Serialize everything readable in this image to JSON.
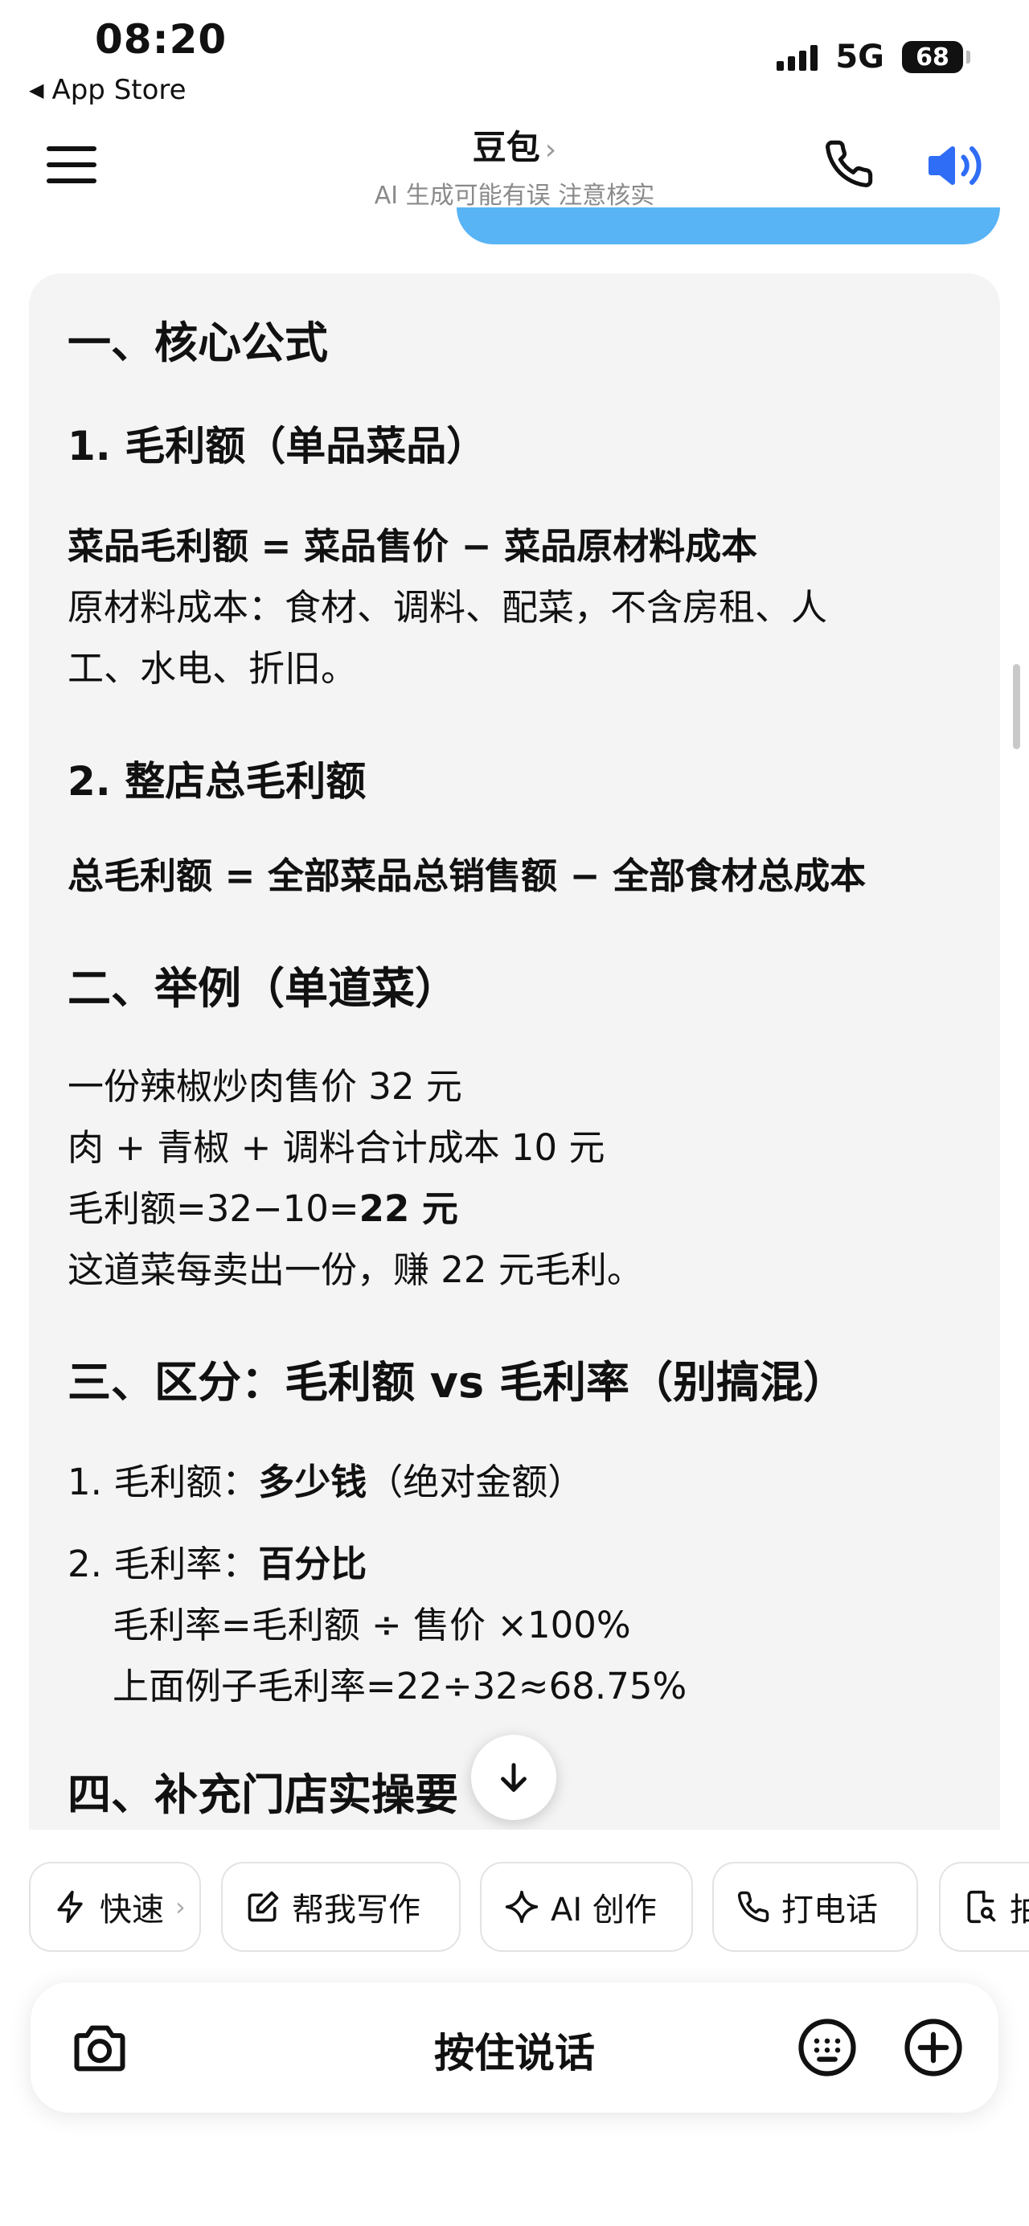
{
  "status_bar": {
    "time": "08:20",
    "back_app": "App Store",
    "network": "5G",
    "battery": "68"
  },
  "header": {
    "title": "豆包",
    "title_chevron": "›",
    "subtitle": "AI 生成可能有误 注意核实"
  },
  "message": {
    "s1_title": "一、核心公式",
    "s1_1_title": "1. 毛利额（单品菜品）",
    "s1_1_formula": "菜品毛利额 = 菜品售价 − 菜品原材料成本",
    "s1_1_note_line1": "原材料成本：食材、调料、配菜，不含房租、人",
    "s1_1_note_line2": "工、水电、折旧。",
    "s1_2_title": "2. 整店总毛利额",
    "s1_2_formula": "总毛利额 = 全部菜品总销售额 − 全部食材总成本",
    "s2_title": "二、举例（单道菜）",
    "s2_line1": "一份辣椒炒肉售价 32 元",
    "s2_line2": "肉 + 青椒 + 调料合计成本 10 元",
    "s2_line3_prefix": "毛利额=32−10=",
    "s2_line3_value": "22 元",
    "s2_line4": "这道菜每卖出一份，赚 22 元毛利。",
    "s3_title": "三、区分：毛利额 vs 毛利率（别搞混）",
    "s3_item1_label": "1. 毛利额：",
    "s3_item1_bold": "多少钱",
    "s3_item1_rest": "（绝对金额）",
    "s3_item2_label": "2. 毛利率：",
    "s3_item2_bold": "百分比",
    "s3_item2_formula": "毛利率=毛利额 ÷ 售价 ×100%",
    "s3_item2_example": "上面例子毛利率=22÷32≈68.75%",
    "s4_title_partial": "四、补充门店实操要"
  },
  "chips": [
    {
      "label": "快速",
      "icon": "lightning-icon",
      "chevron": "›"
    },
    {
      "label": "帮我写作",
      "icon": "edit-icon"
    },
    {
      "label": "AI 创作",
      "icon": "sparkle-icon"
    },
    {
      "label": "打电话",
      "icon": "phone-icon"
    },
    {
      "label": "拍",
      "icon": "document-search-icon"
    }
  ],
  "input_bar": {
    "hold_to_talk": "按住说话"
  },
  "colors": {
    "accent_blue": "#2f6df6",
    "bubble_blue": "#58b4f5",
    "card_bg": "#f4f4f5"
  }
}
